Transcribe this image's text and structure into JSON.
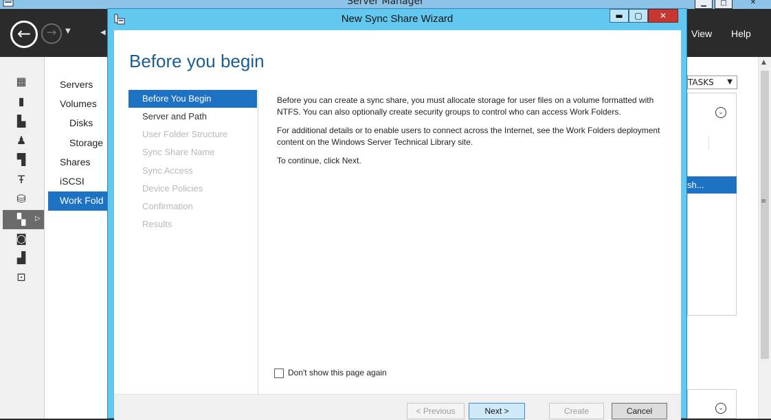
{
  "server_manager": {
    "title": "Server Manager",
    "window_controls": {
      "minimize": "▁",
      "maximize": "□",
      "close": "✕"
    },
    "nav": {
      "back_icon": "arrow-left-icon",
      "forward_icon": "arrow-right-icon"
    },
    "menu": {
      "view": "View",
      "help": "Help"
    },
    "nav_icons": [
      "dashboard-icon",
      "server-icon",
      "servers-icon",
      "users-icon",
      "cluster-icon",
      "tools-icon",
      "storage-icon",
      "file-services-icon",
      "backup-icon",
      "print-icon",
      "remote-desktop-icon"
    ],
    "side_items": [
      {
        "label": "Servers"
      },
      {
        "label": "Volumes"
      },
      {
        "label": "Disks"
      },
      {
        "label": "Storage"
      },
      {
        "label": "Shares"
      },
      {
        "label": "iSCSI"
      },
      {
        "label": "Work Fold"
      }
    ],
    "tasks_label": "TASKS",
    "selected_row_text": "sh..."
  },
  "wizard": {
    "title": "New Sync Share Wizard",
    "controls": {
      "minimize": "▬",
      "maximize": "▢",
      "close": "✕"
    },
    "heading": "Before you begin",
    "steps": [
      {
        "label": "Before You Begin",
        "state": "active"
      },
      {
        "label": "Server and Path",
        "state": "normal"
      },
      {
        "label": "User Folder Structure",
        "state": "disabled"
      },
      {
        "label": "Sync Share Name",
        "state": "disabled"
      },
      {
        "label": "Sync Access",
        "state": "disabled"
      },
      {
        "label": "Device Policies",
        "state": "disabled"
      },
      {
        "label": "Confirmation",
        "state": "disabled"
      },
      {
        "label": "Results",
        "state": "disabled"
      }
    ],
    "description": {
      "p1": "Before you can create a sync share, you must allocate storage for user files on a volume formatted with NTFS. You can also optionally create security groups to control who can access Work Folders.",
      "p2": "For additional details or to enable users to connect across the Internet, see the Work Folders deployment content on the Windows Server Technical Library site.",
      "p3": "To continue, click Next."
    },
    "checkbox_label": "Don't show this page again",
    "buttons": {
      "previous": "< Previous",
      "next": "Next >",
      "create": "Create",
      "cancel": "Cancel"
    }
  }
}
